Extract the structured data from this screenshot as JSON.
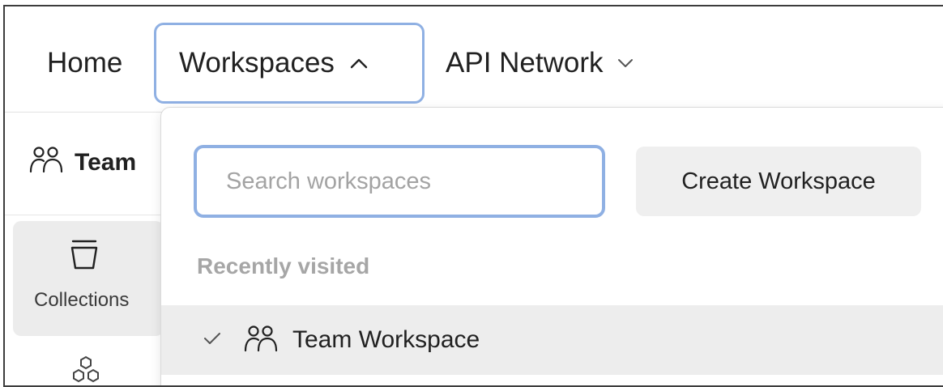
{
  "topnav": {
    "home": "Home",
    "workspaces": "Workspaces",
    "api_network": "API Network"
  },
  "sidebar": {
    "workspace_name": "Team",
    "collections_label": "Collections"
  },
  "dropdown": {
    "search_placeholder": "Search workspaces",
    "create_button": "Create Workspace",
    "recent_heading": "Recently visited",
    "recent_items": [
      {
        "label": "Team Workspace",
        "selected": true
      }
    ]
  },
  "icons": {
    "workspaces_chevron": "chevron-up-icon",
    "api_network_chevron": "chevron-down-icon",
    "team": "people-icon",
    "collections": "bucket-icon",
    "apis": "hexagons-icon",
    "selected": "check-icon"
  },
  "colors": {
    "focus_border": "#8fb0e3",
    "selected_row": "#ededed",
    "muted_text": "#a6a6a6"
  }
}
